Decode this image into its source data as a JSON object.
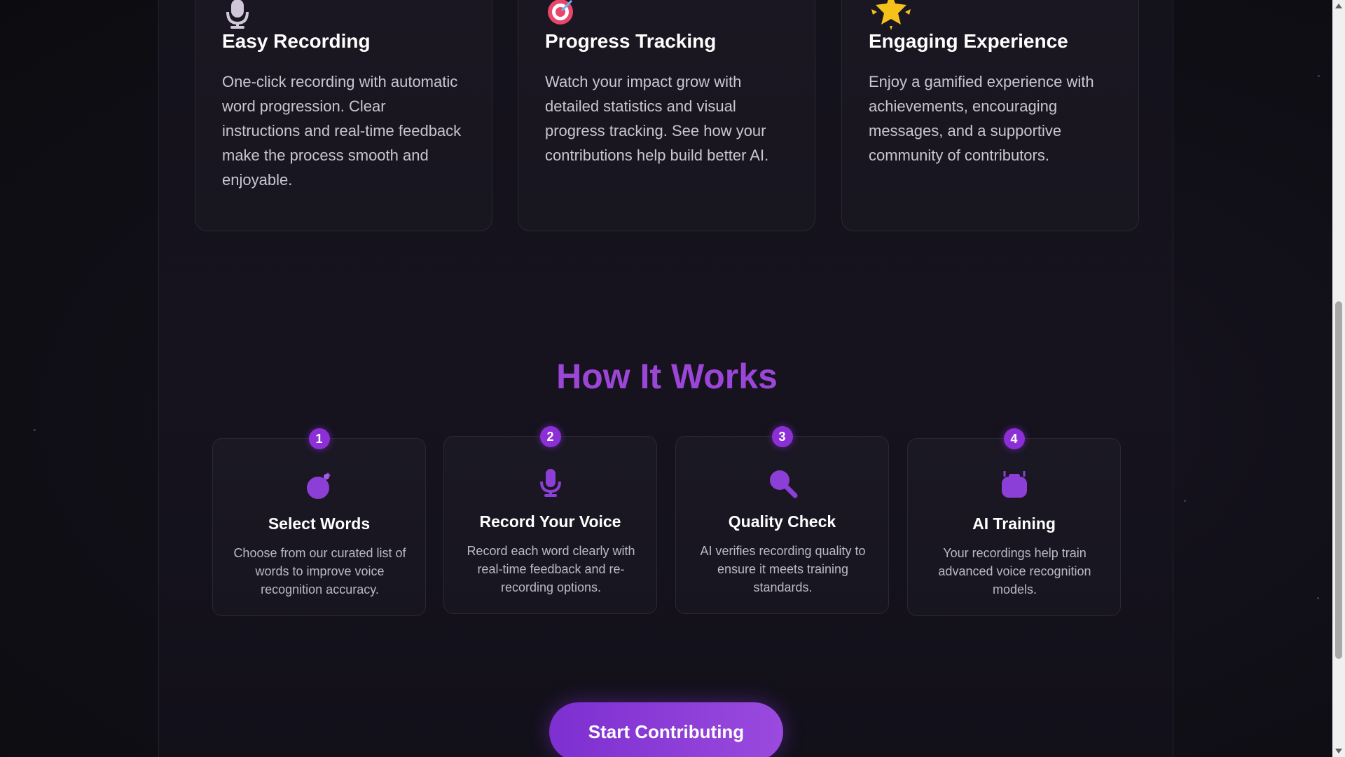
{
  "features": [
    {
      "icon": "microphone-icon",
      "title": "Easy Recording",
      "description": "One-click recording with automatic word progression. Clear instructions and real-time feedback make the process smooth and enjoyable."
    },
    {
      "icon": "target-icon",
      "title": "Progress Tracking",
      "description": "Watch your impact grow with detailed statistics and visual progress tracking. See how your contributions help build better AI."
    },
    {
      "icon": "star-icon",
      "title": "Engaging Experience",
      "description": "Enjoy a gamified experience with achievements, encouraging messages, and a supportive community of contributors."
    }
  ],
  "how_it_works": {
    "title": "How It Works",
    "steps": [
      {
        "number": "1",
        "icon": "apple-icon",
        "title": "Select Words",
        "description": "Choose from our curated list of words to improve voice recognition accuracy."
      },
      {
        "number": "2",
        "icon": "microphone-icon",
        "title": "Record Your Voice",
        "description": "Record each word clearly with real-time feedback and re-recording options."
      },
      {
        "number": "3",
        "icon": "magnifier-icon",
        "title": "Quality Check",
        "description": "AI verifies recording quality to ensure it meets training standards."
      },
      {
        "number": "4",
        "icon": "robot-icon",
        "title": "AI Training",
        "description": "Your recordings help train advanced voice recognition models."
      }
    ]
  },
  "cta": {
    "label": "Start Contributing"
  },
  "colors": {
    "accent": "#9b46d6",
    "badge": "#8c2fd6",
    "background": "#121019",
    "card": "#1a1722"
  }
}
